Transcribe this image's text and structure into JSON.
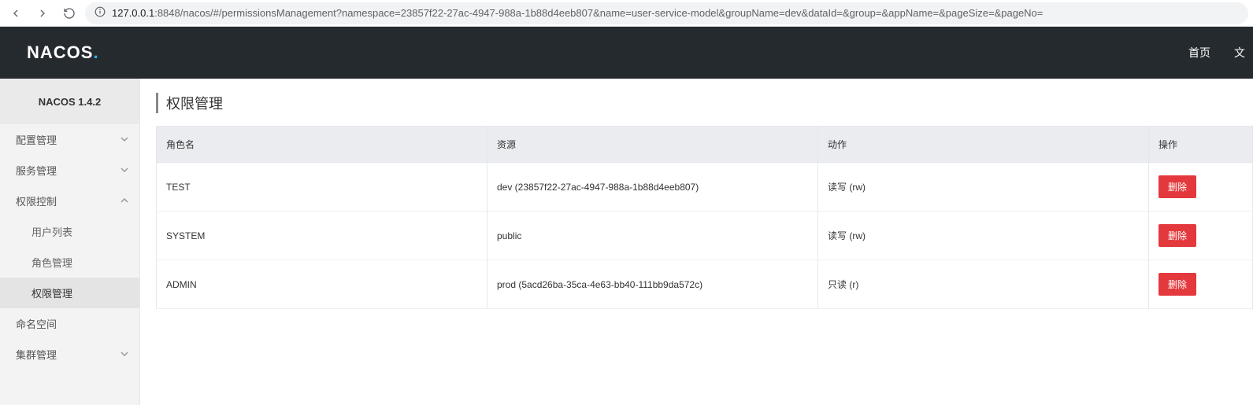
{
  "browser": {
    "url_host": "127.0.0.1",
    "url_path": ":8848/nacos/#/permissionsManagement?namespace=23857f22-27ac-4947-988a-1b88d4eeb807&name=user-service-model&groupName=dev&dataId=&group=&appName=&pageSize=&pageNo="
  },
  "header": {
    "logo_text": "NACOS",
    "logo_dot": ".",
    "nav_home": "首页",
    "nav_docs": "文"
  },
  "sidebar": {
    "version": "NACOS 1.4.2",
    "items": [
      {
        "label": "配置管理",
        "expandable": true,
        "open": false
      },
      {
        "label": "服务管理",
        "expandable": true,
        "open": false
      },
      {
        "label": "权限控制",
        "expandable": true,
        "open": true
      },
      {
        "label": "用户列表",
        "sub": true
      },
      {
        "label": "角色管理",
        "sub": true
      },
      {
        "label": "权限管理",
        "sub": true,
        "selected": true
      },
      {
        "label": "命名空间",
        "expandable": false
      },
      {
        "label": "集群管理",
        "expandable": true,
        "open": false
      }
    ]
  },
  "page": {
    "title": "权限管理",
    "columns": {
      "role": "角色名",
      "resource": "资源",
      "action": "动作",
      "op": "操作"
    },
    "delete_label": "删除",
    "rows": [
      {
        "role": "TEST",
        "resource": "dev (23857f22-27ac-4947-988a-1b88d4eeb807)",
        "action": "读写 (rw)"
      },
      {
        "role": "SYSTEM",
        "resource": "public",
        "action": "读写 (rw)"
      },
      {
        "role": "ADMIN",
        "resource": "prod (5acd26ba-35ca-4e63-bb40-111bb9da572c)",
        "action": "只读 (r)"
      }
    ]
  }
}
